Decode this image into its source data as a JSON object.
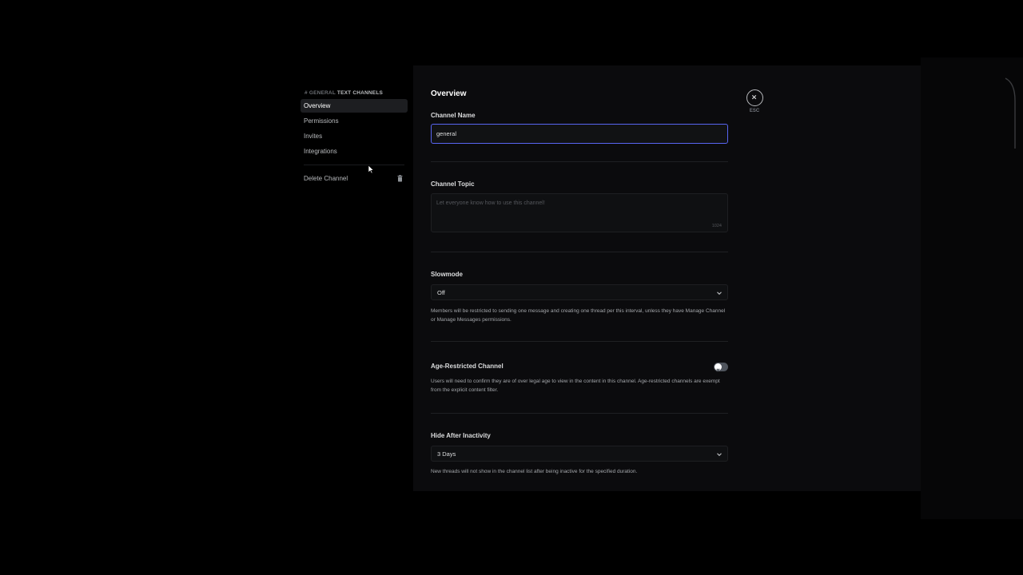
{
  "sidebar": {
    "header_hash": "# GENERAL",
    "header_label": "TEXT CHANNELS",
    "items": [
      {
        "label": "Overview",
        "active": true
      },
      {
        "label": "Permissions"
      },
      {
        "label": "Invites"
      },
      {
        "label": "Integrations"
      }
    ],
    "delete_label": "Delete Channel"
  },
  "overview": {
    "title": "Overview",
    "channel_name_label": "Channel Name",
    "channel_name_value": "general",
    "channel_topic_label": "Channel Topic",
    "channel_topic_placeholder": "Let everyone know how to use this channel!",
    "channel_topic_counter": "1024",
    "slowmode_label": "Slowmode",
    "slowmode_value": "Off",
    "slowmode_desc": "Members will be restricted to sending one message and creating one thread per this interval, unless they have Manage Channel or Manage Messages permissions.",
    "age_label": "Age-Restricted Channel",
    "age_desc": "Users will need to confirm they are of over legal age to view in the content in this channel. Age-restricted channels are exempt from the explicit content filter.",
    "age_enabled": false,
    "hide_label": "Hide After Inactivity",
    "hide_value": "3 Days",
    "hide_desc": "New threads will not show in the channel list after being inactive for the specified duration."
  },
  "close": {
    "esc_label": "ESC"
  },
  "icons": {
    "close": "close-icon",
    "delete": "trash-icon",
    "dropdown": "chevron-down-icon",
    "toggle": "x-icon",
    "cursor": "mouse-cursor-icon"
  },
  "colors": {
    "accent": "#5865f2",
    "background": "#000000",
    "panel": "#0b0b0d"
  }
}
